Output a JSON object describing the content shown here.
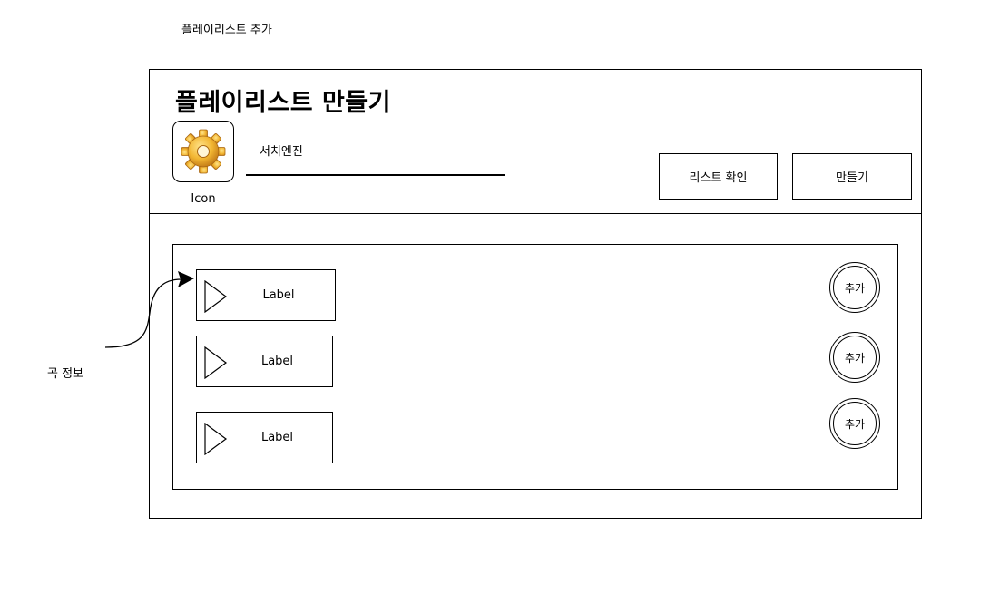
{
  "page": {
    "caption": "플레이리스트 추가"
  },
  "header": {
    "title": "플레이리스트 만들기",
    "icon": {
      "name": "gear-icon",
      "label": "Icon"
    },
    "search": {
      "label": "서치엔진"
    },
    "buttons": {
      "list_check": "리스트 확인",
      "create": "만들기"
    }
  },
  "songs": [
    {
      "label": "Label",
      "add_label": "추가",
      "icon": "play-icon"
    },
    {
      "label": "Label",
      "add_label": "추가",
      "icon": "play-icon"
    },
    {
      "label": "Label",
      "add_label": "추가",
      "icon": "play-icon"
    }
  ],
  "annotation": {
    "text": "곡 정보"
  },
  "colors": {
    "stroke": "#000000",
    "background": "#ffffff",
    "gear": "#f2b632"
  }
}
